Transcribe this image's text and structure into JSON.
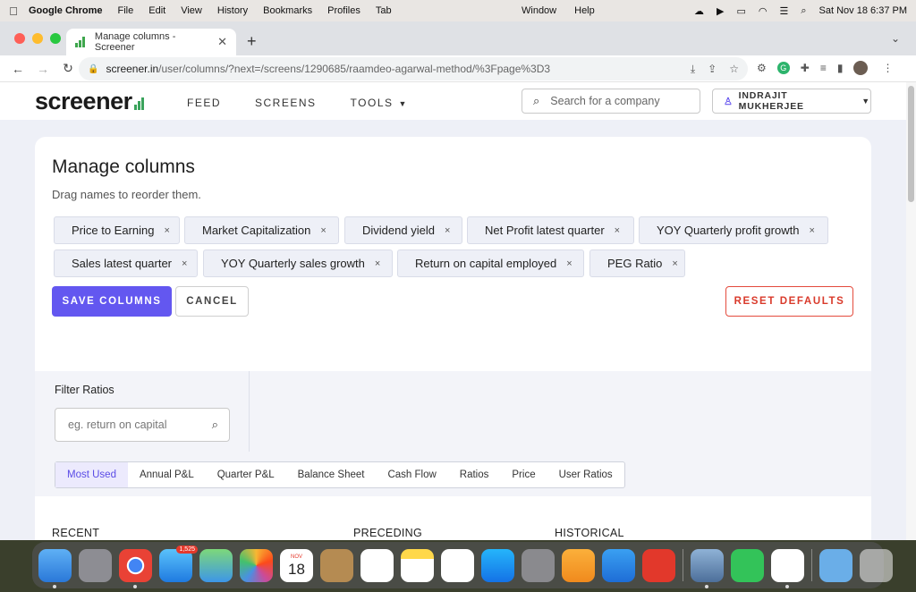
{
  "menubar": {
    "app_name": "Google Chrome",
    "items": [
      "File",
      "Edit",
      "View",
      "History",
      "Bookmarks",
      "Profiles",
      "Tab"
    ],
    "middle_items": [
      "Window",
      "Help"
    ],
    "datetime": "Sat Nov 18  6:37 PM"
  },
  "browser": {
    "tab_title": "Manage columns - Screener",
    "url_domain": "screener.in",
    "url_path": "/user/columns/?next=/screens/1290685/raamdeo-agarwal-method/%3Fpage%3D3"
  },
  "site": {
    "logo_text": "screener",
    "nav": [
      "FEED",
      "SCREENS",
      "TOOLS"
    ],
    "search_placeholder": "Search for a company",
    "user_name": "INDRAJIT MUKHERJEE"
  },
  "manage": {
    "title": "Manage columns",
    "subtitle": "Drag names to reorder them.",
    "columns": [
      "Price to Earning",
      "Market Capitalization",
      "Dividend yield",
      "Net Profit latest quarter",
      "YOY Quarterly profit growth",
      "Sales latest quarter",
      "YOY Quarterly sales growth",
      "Return on capital employed",
      "PEG Ratio"
    ],
    "remove_glyph": "×",
    "save_label": "SAVE COLUMNS",
    "cancel_label": "CANCEL",
    "reset_label": "RESET DEFAULTS"
  },
  "filter": {
    "label": "Filter Ratios",
    "placeholder": "eg. return on capital",
    "tabs": [
      "Most Used",
      "Annual P&L",
      "Quarter P&L",
      "Balance Sheet",
      "Cash Flow",
      "Ratios",
      "Price",
      "User Ratios"
    ],
    "active_tab": "Most Used",
    "column_headings": [
      "RECENT",
      "PRECEDING",
      "HISTORICAL"
    ]
  },
  "dock": {
    "mail_badge": "1,525",
    "calendar_month": "NOV",
    "calendar_day": "18"
  }
}
